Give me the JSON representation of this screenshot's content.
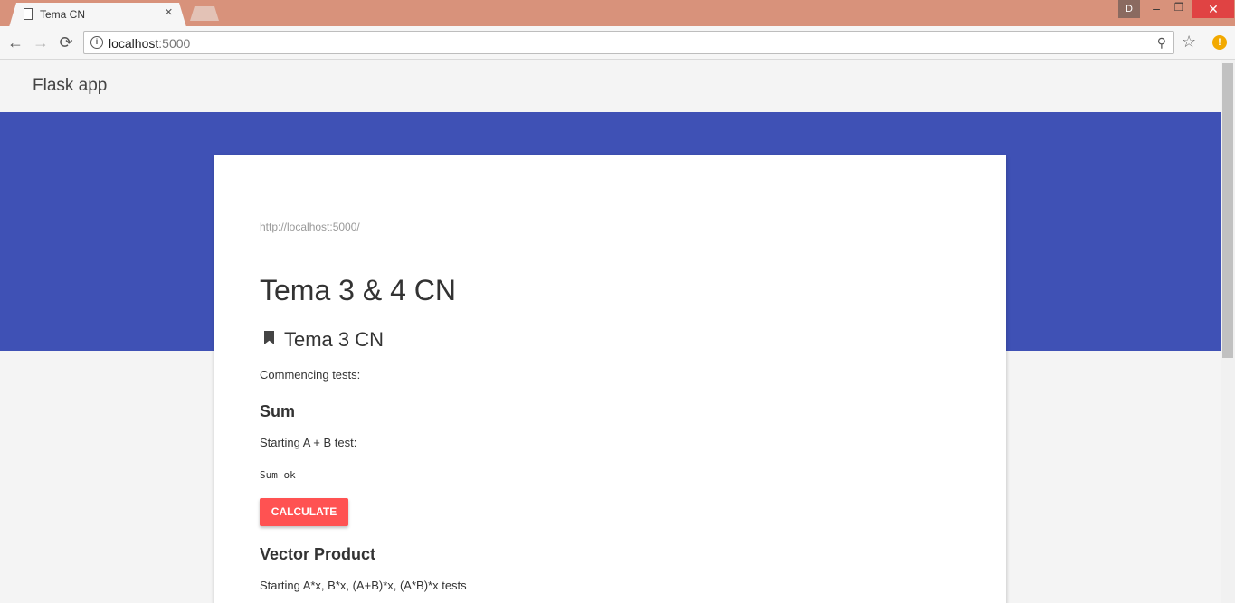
{
  "browser": {
    "tab_title": "Tema CN",
    "tab_close": "×",
    "user_initial": "D",
    "url_host": "localhost",
    "url_port": ":5000",
    "window_controls": {
      "minimize": "–",
      "maximize": "❐",
      "close": "✕"
    },
    "icons": {
      "back": "←",
      "forward": "→",
      "reload": "⟳",
      "info": "i",
      "zoom": "⚲",
      "star": "☆",
      "extension": "!"
    }
  },
  "app": {
    "title": "Flask app",
    "accent_color": "#3f51b5",
    "button_color": "#ff5252"
  },
  "card": {
    "url": "http://localhost:5000/",
    "heading": "Tema 3 & 4 CN",
    "subheading": "Tema 3 CN",
    "intro": "Commencing tests:",
    "sections": [
      {
        "title": "Sum",
        "description": "Starting A + B test:",
        "result": "Sum ok",
        "button_label": "CALCULATE"
      },
      {
        "title": "Vector Product",
        "description": "Starting A*x, B*x, (A+B)*x, (A*B)*x tests"
      }
    ]
  }
}
